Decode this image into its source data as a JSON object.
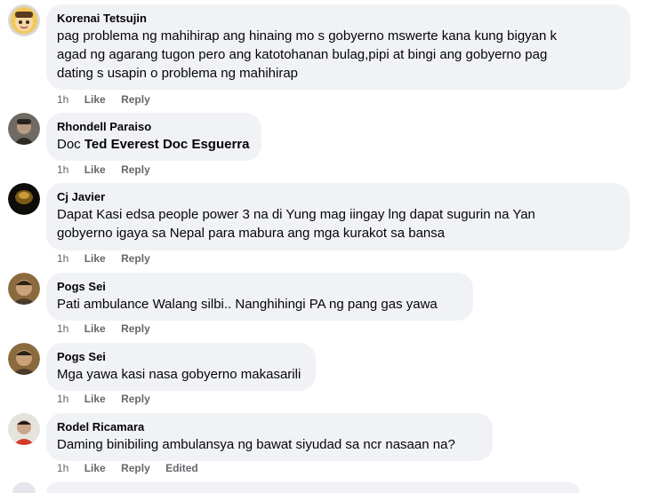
{
  "comments": [
    {
      "author": "Korenai Tetsujin",
      "text_lines": [
        "pag problema ng mahihirap ang hinaing mo s gobyerno mswerte kana kung bigyan k",
        "agad ng agarang tugon pero ang katotohanan bulag,pipi at bingi ang gobyerno pag",
        "dating s usapin o problema ng mahihirap"
      ],
      "time": "1h",
      "like": "Like",
      "reply": "Reply"
    },
    {
      "author": "Rhondell Paraiso",
      "text_prefix": "Doc ",
      "mention": "Ted Everest Doc Esguerra",
      "time": "1h",
      "like": "Like",
      "reply": "Reply"
    },
    {
      "author": "Cj Javier",
      "text_lines": [
        "Dapat Kasi edsa people power 3 na di Yung mag iingay lng dapat sugurin na Yan",
        "gobyerno igaya sa Nepal para mabura ang mga kurakot sa bansa"
      ],
      "time": "1h",
      "like": "Like",
      "reply": "Reply"
    },
    {
      "author": "Pogs Sei",
      "text_lines": [
        "Pati ambulance Walang silbi.. Nanghihingi PA ng pang gas yawa"
      ],
      "time": "1h",
      "like": "Like",
      "reply": "Reply"
    },
    {
      "author": "Pogs Sei",
      "text_lines": [
        "Mga yawa kasi nasa gobyerno makasarili"
      ],
      "time": "1h",
      "like": "Like",
      "reply": "Reply"
    },
    {
      "author": "Rodel Ricamara",
      "text_lines": [
        "Daming binibiling ambulansya ng bawat siyudad sa ncr nasaan na?"
      ],
      "time": "1h",
      "like": "Like",
      "reply": "Reply",
      "edited": "Edited"
    }
  ],
  "colors": {
    "bubble_bg": "#f0f2f5",
    "text": "#050505",
    "meta": "#65676b"
  }
}
